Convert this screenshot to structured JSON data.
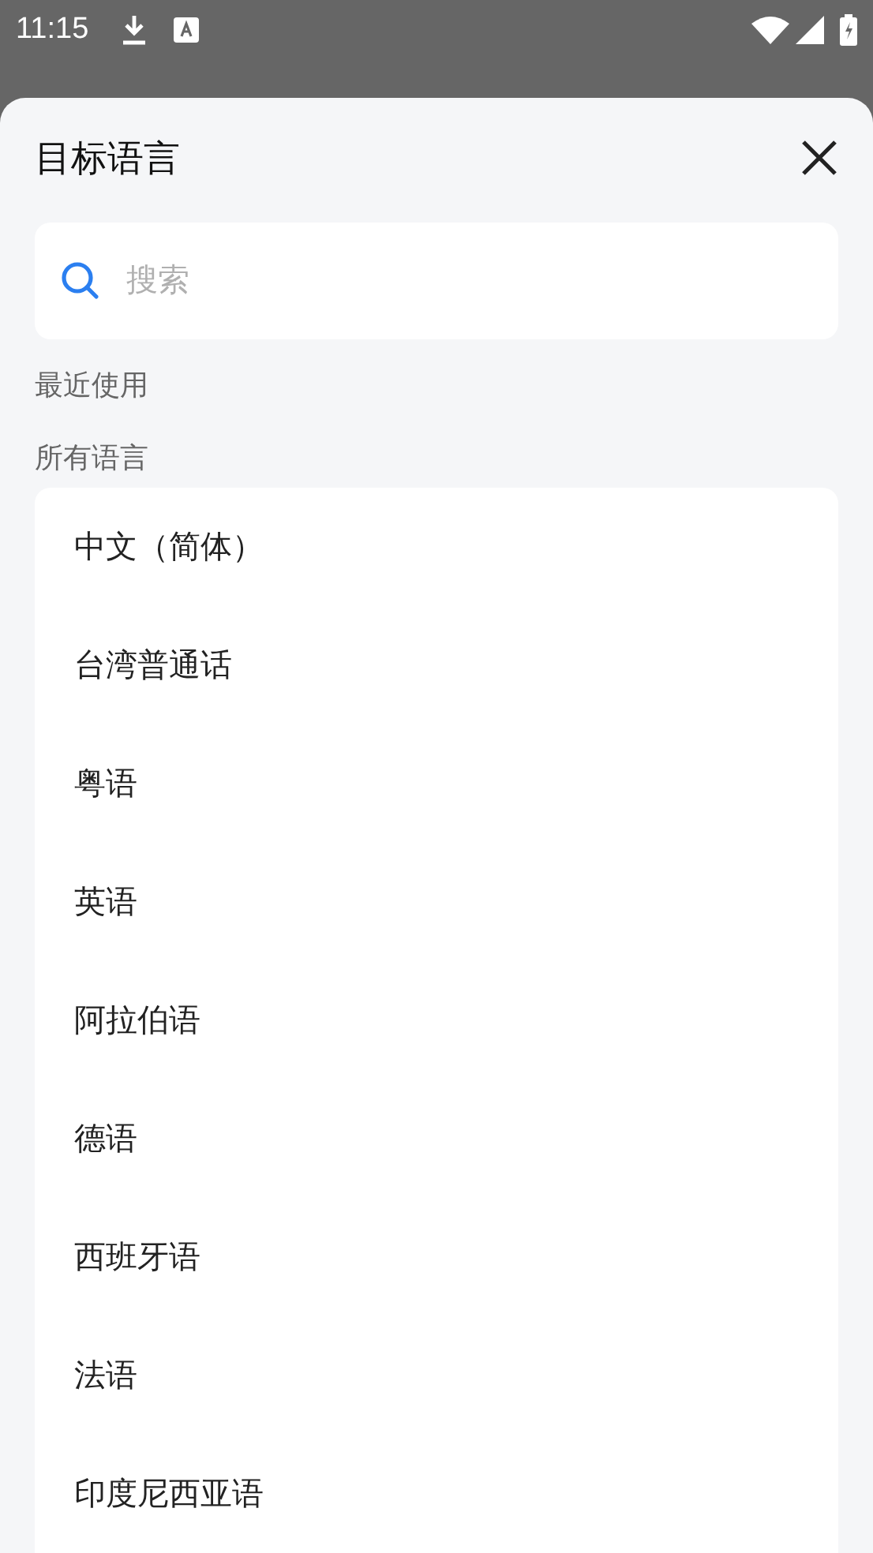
{
  "status_bar": {
    "time": "11:15"
  },
  "sheet": {
    "title": "目标语言"
  },
  "search": {
    "placeholder": "搜索"
  },
  "sections": [
    {
      "label": "最近使用"
    },
    {
      "label": "所有语言"
    }
  ],
  "languages": [
    {
      "name": "中文（简体）"
    },
    {
      "name": "台湾普通话"
    },
    {
      "name": "粤语"
    },
    {
      "name": "英语"
    },
    {
      "name": "阿拉伯语"
    },
    {
      "name": "德语"
    },
    {
      "name": "西班牙语"
    },
    {
      "name": "法语"
    },
    {
      "name": "印度尼西亚语"
    }
  ]
}
